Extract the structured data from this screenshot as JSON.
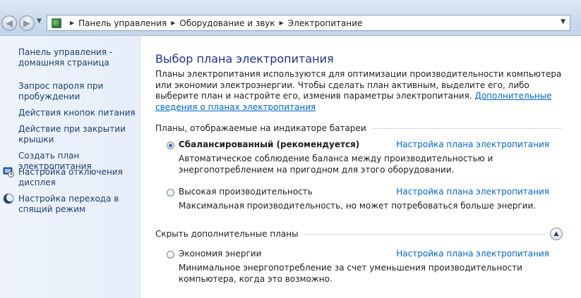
{
  "breadcrumb": [
    "Панель управления",
    "Оборудование и звук",
    "Электропитание"
  ],
  "icons": {
    "back": "back-arrow-icon",
    "forward": "forward-arrow-icon",
    "control_panel": "control-panel-icon"
  },
  "sidebar": {
    "links": [
      {
        "label": "Панель управления - домашняя страница"
      },
      {
        "label": "Запрос пароля при пробуждении"
      },
      {
        "label": "Действия кнопок питания"
      },
      {
        "label": "Действие при закрытии крышки"
      },
      {
        "label": "Создать план электропитания"
      },
      {
        "label": "Настройка отключения дисплея",
        "icon": "display-icon"
      },
      {
        "label": "Настройка перехода в спящий режим",
        "icon": "moon-icon"
      }
    ]
  },
  "main": {
    "title": "Выбор плана электропитания",
    "intro": "Планы электропитания используются для оптимизации производительности компьютера или экономии электроэнергии. Чтобы сделать план активным, выделите его, либо выберите план и настройте его, изменив параметры электропитания.",
    "intro_link": "Дополнительные сведения о планах электропитания",
    "battery_section": "Планы, отображаемые на индикаторе батареи",
    "hidden_section": "Скрыть дополнительные планы",
    "plans": [
      {
        "name": "Сбалансированный (рекомендуется)",
        "description": "Автоматическое соблюдение баланса между производительностью и энергопотреблением на пригодном для этого оборудовании.",
        "link": "Настройка плана электропитания",
        "selected": true
      },
      {
        "name": "Высокая производительность",
        "description": "Максимальная производительность, но может потребоваться больше энергии.",
        "link": "Настройка плана электропитания",
        "selected": false
      },
      {
        "name": "Экономия энергии",
        "description": "Минимальное энергопотребление за счет уменьшения производительности компьютера, когда это возможно.",
        "link": "Настройка плана электропитания",
        "selected": false
      }
    ]
  },
  "colors": {
    "title": "#1e3287",
    "link": "#0066cc",
    "sidebar_link": "#1e3f6e",
    "sidebar_bg": "#e6eef9"
  }
}
